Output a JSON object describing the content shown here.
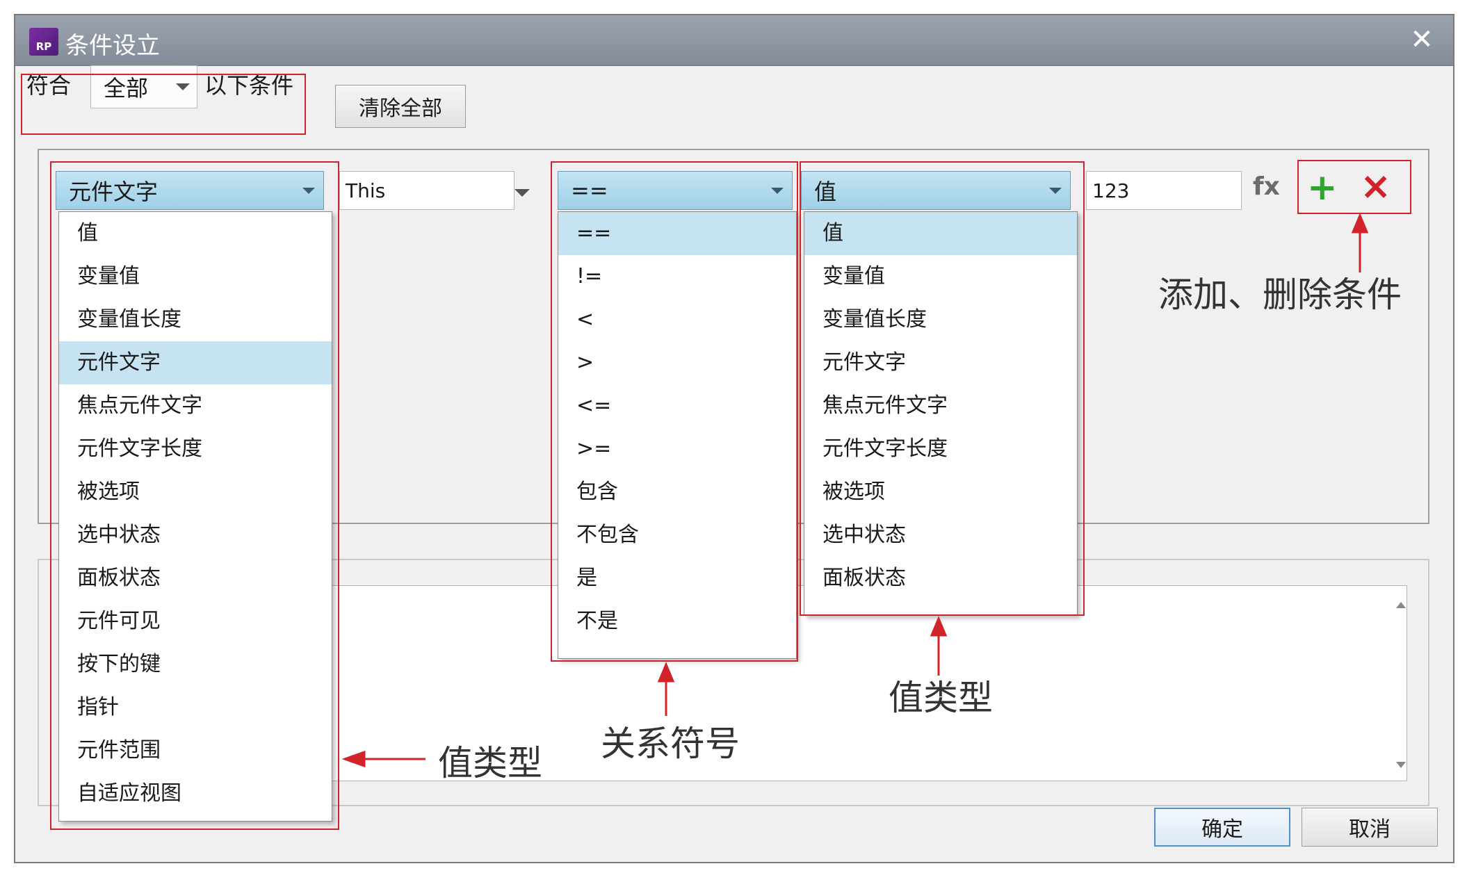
{
  "window": {
    "app_icon_text": "RP",
    "title": "条件设立",
    "close_symbol": "✕"
  },
  "match_row": {
    "prefix": "符合",
    "mode_value": "全部",
    "suffix": "以下条件",
    "clear_all_label": "清除全部"
  },
  "condition": {
    "left_type": "元件文字",
    "target": "This",
    "operator": "==",
    "right_type": "值",
    "right_value": "123",
    "fx_label": "fx",
    "add_symbol": "+",
    "delete_symbol": "×"
  },
  "left_menu": {
    "selected": "元件文字",
    "items": [
      "值",
      "变量值",
      "变量值长度",
      "元件文字",
      "焦点元件文字",
      "元件文字长度",
      "被选项",
      "选中状态",
      "面板状态",
      "元件可见",
      "按下的键",
      "指针",
      "元件范围",
      "自适应视图"
    ]
  },
  "operator_menu": {
    "selected": "==",
    "items": [
      "==",
      "!=",
      "<",
      ">",
      "<=",
      ">=",
      "包含",
      "不包含",
      "是",
      "不是"
    ]
  },
  "right_menu": {
    "selected": "值",
    "items": [
      "值",
      "变量值",
      "变量值长度",
      "元件文字",
      "焦点元件文字",
      "元件文字长度",
      "被选项",
      "选中状态",
      "面板状态"
    ]
  },
  "annotations": {
    "add_delete": "添加、删除条件",
    "value_type_right": "值类型",
    "relation_symbol": "关系符号",
    "value_type_left": "值类型"
  },
  "footer": {
    "ok_label": "确定",
    "cancel_label": "取消"
  },
  "colors": {
    "highlight_red": "#d2232a",
    "add_green": "#2ea62e",
    "delete_red": "#d2232a",
    "selected_blue": "#c5e3f0"
  }
}
